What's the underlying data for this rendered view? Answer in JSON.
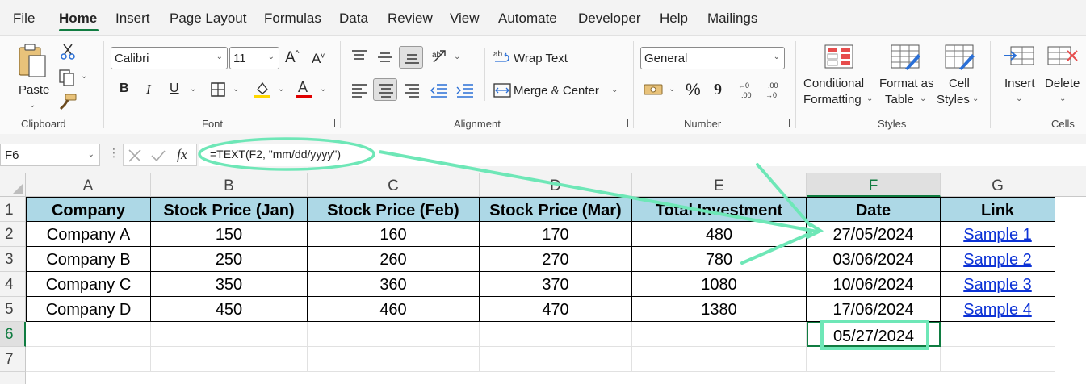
{
  "ribbon_tabs": [
    "File",
    "Home",
    "Insert",
    "Page Layout",
    "Formulas",
    "Data",
    "Review",
    "View",
    "Automate",
    "Developer",
    "Help",
    "Mailings"
  ],
  "active_tab": "Home",
  "clipboard": {
    "paste_label": "Paste",
    "group_label": "Clipboard"
  },
  "font": {
    "family": "Calibri",
    "size": "11",
    "group_label": "Font",
    "bold": "B",
    "italic": "I",
    "underline": "U",
    "fill_color": "#ffd700",
    "font_color": "#e00000"
  },
  "alignment": {
    "wrap_text": "Wrap Text",
    "merge_center": "Merge & Center",
    "group_label": "Alignment"
  },
  "number": {
    "format": "General",
    "percent": "%",
    "comma": "9",
    "group_label": "Number"
  },
  "styles": {
    "conditional_1": "Conditional",
    "conditional_2": "Formatting",
    "format_table_1": "Format as",
    "format_table_2": "Table",
    "cell_styles_1": "Cell",
    "cell_styles_2": "Styles",
    "group_label": "Styles"
  },
  "cells": {
    "insert": "Insert",
    "delete": "Delete",
    "group_label": "Cells"
  },
  "formula_bar": {
    "name_box": "F6",
    "fx": "fx",
    "formula": "=TEXT(F2, \"mm/dd/yyyy\")"
  },
  "columns": [
    "A",
    "B",
    "C",
    "D",
    "E",
    "F",
    "G"
  ],
  "selected_column": "F",
  "rows": [
    "1",
    "2",
    "3",
    "4",
    "5",
    "6",
    "7"
  ],
  "selected_row": "6",
  "table": {
    "headers": [
      "Company",
      "Stock Price (Jan)",
      "Stock Price (Feb)",
      "Stock Price (Mar)",
      "Total Investment",
      "Date",
      "Link"
    ],
    "rows": [
      [
        "Company A",
        "150",
        "160",
        "170",
        "480",
        "27/05/2024",
        "Sample 1"
      ],
      [
        "Company B",
        "250",
        "260",
        "270",
        "780",
        "03/06/2024",
        "Sample 2"
      ],
      [
        "Company C",
        "350",
        "360",
        "370",
        "1080",
        "10/06/2024",
        "Sample 3"
      ],
      [
        "Company D",
        "450",
        "460",
        "470",
        "1380",
        "17/06/2024",
        "Sample 4"
      ]
    ]
  },
  "result_cell": {
    "ref": "F6",
    "value": "05/27/2024"
  },
  "annotation_color": "#6ee7b7",
  "header_fill": "#add8e6",
  "accent": "#107c41"
}
